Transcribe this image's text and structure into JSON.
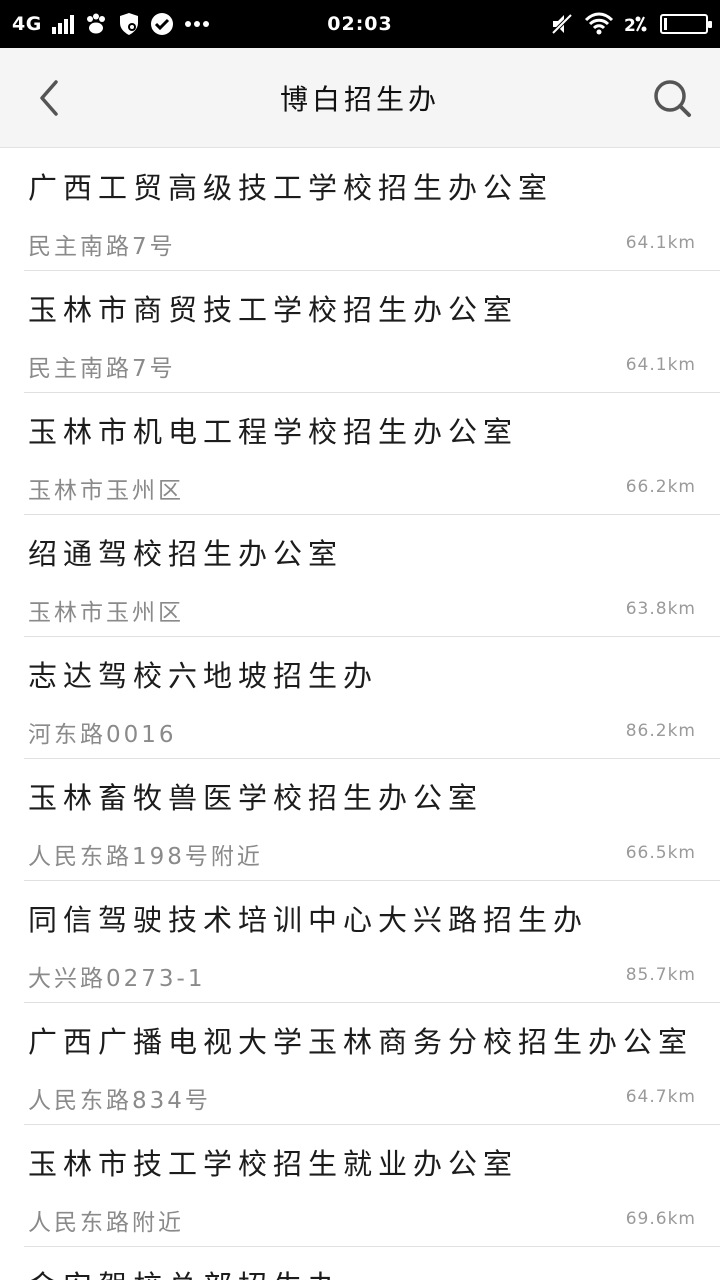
{
  "status_bar": {
    "network": "4G",
    "time": "02:03",
    "icons": [
      "signal-icon",
      "baidu-paw-icon",
      "shield-icon",
      "check-circle-icon",
      "more-dots-icon",
      "mute-icon",
      "wifi-icon",
      "data-speed-icon",
      "battery-icon"
    ],
    "battery_level": 0.05
  },
  "nav": {
    "title": "博白招生办",
    "back_icon": "chevron-left-icon",
    "search_icon": "search-icon"
  },
  "results": [
    {
      "name": "广西工贸高级技工学校招生办公室",
      "address": "民主南路7号",
      "distance": "64.1km"
    },
    {
      "name": "玉林市商贸技工学校招生办公室",
      "address": "民主南路7号",
      "distance": "64.1km"
    },
    {
      "name": "玉林市机电工程学校招生办公室",
      "address": "玉林市玉州区",
      "distance": "66.2km"
    },
    {
      "name": "绍通驾校招生办公室",
      "address": "玉林市玉州区",
      "distance": "63.8km"
    },
    {
      "name": "志达驾校六地坡招生办",
      "address": "河东路0016",
      "distance": "86.2km"
    },
    {
      "name": "玉林畜牧兽医学校招生办公室",
      "address": "人民东路198号附近",
      "distance": "66.5km"
    },
    {
      "name": "同信驾驶技术培训中心大兴路招生办",
      "address": "大兴路0273-1",
      "distance": "85.7km"
    },
    {
      "name": "广西广播电视大学玉林商务分校招生办公室",
      "address": "人民东路834号",
      "distance": "64.7km"
    },
    {
      "name": "玉林市技工学校招生就业办公室",
      "address": "人民东路附近",
      "distance": "69.6km"
    },
    {
      "name": "金安驾校总部招生办",
      "address": "",
      "distance": ""
    }
  ]
}
